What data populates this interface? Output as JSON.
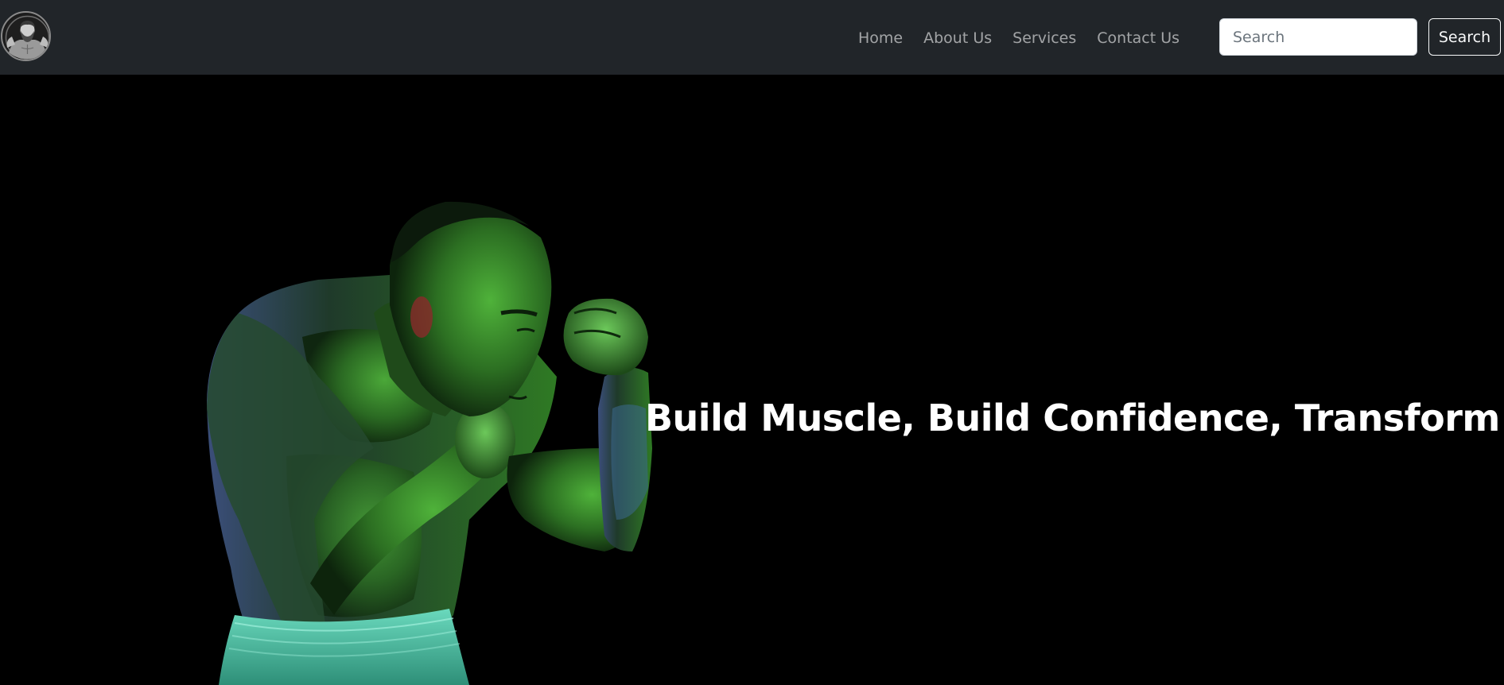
{
  "navbar": {
    "logo_icon": "bearded-fitness-man-logo-icon",
    "links": [
      {
        "label": "Home"
      },
      {
        "label": "About Us"
      },
      {
        "label": "Services"
      },
      {
        "label": "Contact Us"
      }
    ],
    "search": {
      "placeholder": "Search",
      "value": "",
      "button_label": "Search"
    }
  },
  "hero": {
    "title": "Build Muscle, Build Confidence, Transform Life",
    "image": "boxer-green-lit-photo"
  },
  "colors": {
    "navbar_bg": "#212529",
    "hero_bg": "#000000",
    "nav_link": "rgba(255,255,255,0.58)",
    "hero_title": "#ffffff",
    "figure_green": "#4caf3a",
    "shorts_teal": "#5fd3b5"
  }
}
